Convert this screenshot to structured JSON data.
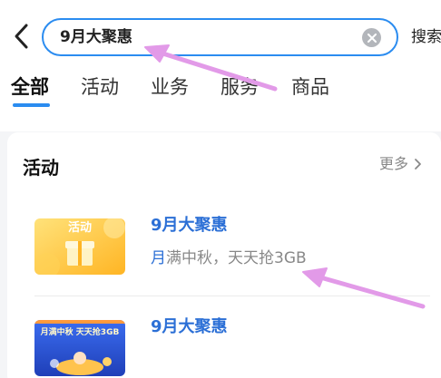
{
  "search": {
    "value": "9月大聚惠",
    "button_label": "搜索"
  },
  "tabs": [
    {
      "label": "全部",
      "active": true
    },
    {
      "label": "活动",
      "active": false
    },
    {
      "label": "业务",
      "active": false
    },
    {
      "label": "服务",
      "active": false
    },
    {
      "label": "商品",
      "active": false
    }
  ],
  "section": {
    "title": "活动",
    "more_label": "更多",
    "items": [
      {
        "title": "9月大聚惠",
        "desc_highlight": "月",
        "desc_rest": "满中秋，天天抢3GB",
        "thumb_label": "活动"
      },
      {
        "title": "9月大聚惠",
        "thumb_label": "月满中秋 天天抢3GB"
      }
    ]
  },
  "colors": {
    "accent": "#2b8cf0",
    "link": "#2b6fd6",
    "annotation_arrow": "#e29ae8"
  },
  "icons": {
    "back": "chevron-left-icon",
    "clear": "clear-x-icon",
    "more": "chevron-right-icon",
    "thumb1": "gift-icon"
  }
}
